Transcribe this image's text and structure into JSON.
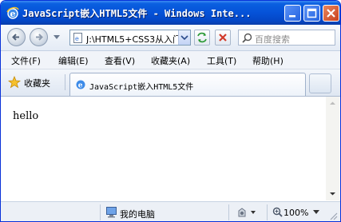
{
  "window": {
    "title": "JavaScript嵌入HTML5文件 - Windows Inte..."
  },
  "address": {
    "value": "J:\\HTML5+CSS3从入门"
  },
  "search": {
    "placeholder": "百度搜索"
  },
  "menu": {
    "items": [
      "文件(F)",
      "编辑(E)",
      "查看(V)",
      "收藏夹(A)",
      "工具(T)",
      "帮助(H)"
    ]
  },
  "favorites": {
    "label": "收藏夹"
  },
  "tab": {
    "title": "JavaScript嵌入HTML5文件"
  },
  "page": {
    "body_text": "hello"
  },
  "status": {
    "zone": "我的电脑",
    "zoom": "100%"
  },
  "icons": [
    "ie-logo-icon",
    "minimize-icon",
    "maximize-icon",
    "close-icon",
    "back-icon",
    "forward-icon",
    "refresh-icon",
    "stop-icon",
    "search-icon",
    "star-icon",
    "page-icon",
    "computer-icon",
    "zoom-icon",
    "security-icon"
  ],
  "colors": {
    "titlebar": "#0552d8",
    "close_button": "#c9411c",
    "chrome": "#e4ebf5"
  }
}
